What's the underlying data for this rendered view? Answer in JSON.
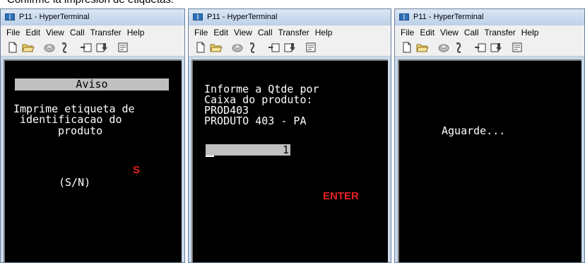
{
  "caption": "Confirme la impresión de etiquetas.",
  "windows": [
    {
      "title": "P11 - HyperTerminal",
      "menu": [
        "File",
        "Edit",
        "View",
        "Call",
        "Transfer",
        "Help"
      ],
      "screen": {
        "header": "Aviso",
        "line1": "Imprime etiqueta de",
        "line2": "identificacao do",
        "line3": "produto",
        "prompt": "(S/N)",
        "annotation": "S"
      }
    },
    {
      "title": "P11 - HyperTerminal",
      "menu": [
        "File",
        "Edit",
        "View",
        "Call",
        "Transfer",
        "Help"
      ],
      "screen": {
        "line1": "Informe a Qtde por",
        "line2": "Caixa do produto:",
        "line3": "PROD403",
        "line4": "PRODUTO 403 - PA",
        "input_value": "1",
        "annotation": "ENTER"
      }
    },
    {
      "title": "P11 - HyperTerminal",
      "menu": [
        "File",
        "Edit",
        "View",
        "Call",
        "Transfer",
        "Help"
      ],
      "screen": {
        "line1": "Aguarde..."
      }
    }
  ],
  "toolbar_icons": [
    "new-icon",
    "open-icon",
    "disconnect-icon",
    "connect-icon",
    "send-icon",
    "receive-icon",
    "properties-icon"
  ],
  "colors": {
    "annotation": "#e8201f",
    "terminal_bg": "#000000",
    "terminal_fg": "#ffffff"
  }
}
